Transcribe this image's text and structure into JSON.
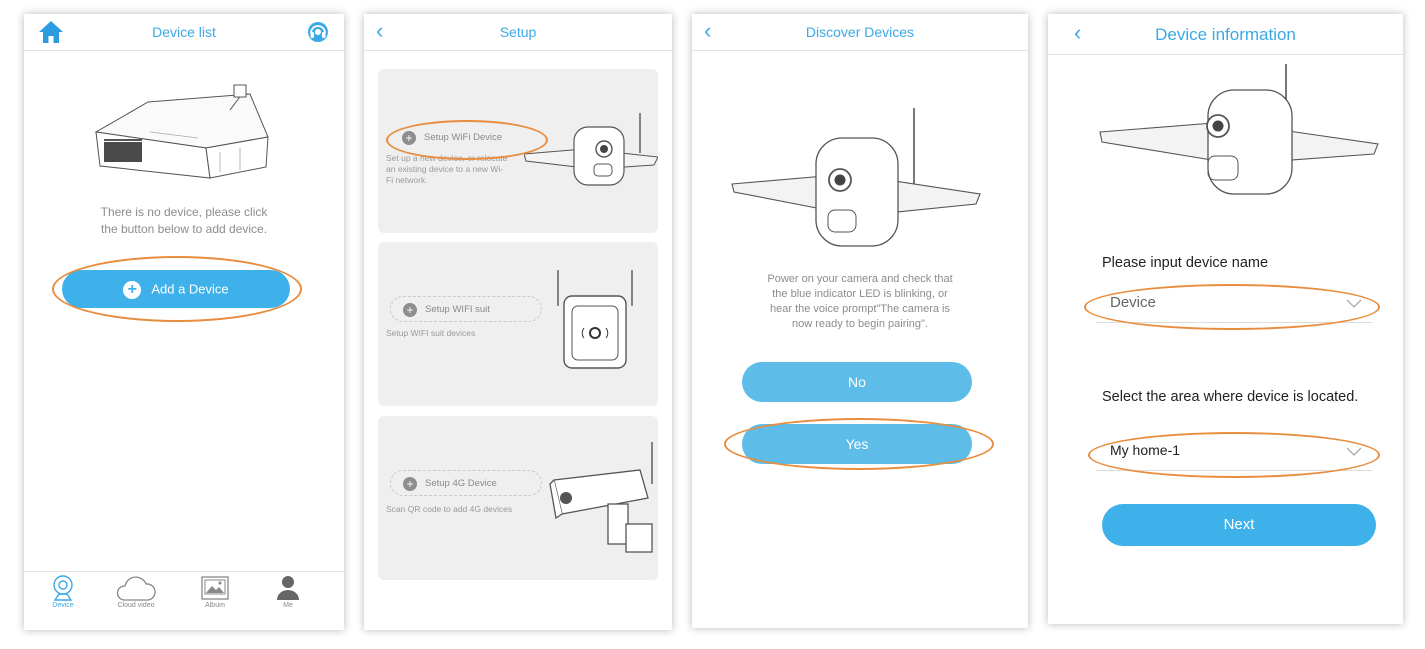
{
  "colors": {
    "accent": "#3aa9e6",
    "button": "#5dbce8",
    "highlight_oval": "#e88d3e"
  },
  "screen1": {
    "title": "Device list",
    "left_icon": "home-icon",
    "right_icon": "support-headset-icon",
    "empty_message_line1": "There is no device, please click",
    "empty_message_line2": "the button below to add device.",
    "add_button_label": "Add a Device",
    "tabs": [
      {
        "label": "Device",
        "icon": "camera-icon"
      },
      {
        "label": "Cloud video",
        "icon": "cloud-icon"
      },
      {
        "label": "Album",
        "icon": "album-icon"
      },
      {
        "label": "Me",
        "icon": "person-icon"
      }
    ]
  },
  "screen2": {
    "title": "Setup",
    "cards": [
      {
        "button": "Setup WiFi Device",
        "desc_line1": "Set up a new device, or relocate",
        "desc_line2": "an existing device to a new Wi-",
        "desc_line3": "Fi network."
      },
      {
        "button": "Setup WIFI suit",
        "desc_line1": "Setup WIFI suit devices"
      },
      {
        "button": "Setup 4G Device",
        "desc_line1": "Scan QR code to add 4G devices"
      }
    ]
  },
  "screen3": {
    "title": "Discover Devices",
    "instruction_line1": "Power on your camera and check that",
    "instruction_line2": "the blue indicator LED is blinking, or",
    "instruction_line3": "hear the voice prompt\"The camera is",
    "instruction_line4": "now ready to begin pairing\".",
    "no_label": "No",
    "yes_label": "Yes"
  },
  "screen4": {
    "title": "Device information",
    "name_label": "Please input device name",
    "name_value": "Device",
    "area_label": "Select the area where device is located.",
    "area_value": "My home-1",
    "next_label": "Next"
  }
}
